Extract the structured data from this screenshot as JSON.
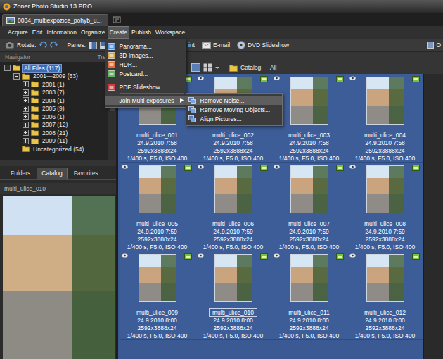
{
  "window": {
    "title": "Zoner Photo Studio 13 PRO"
  },
  "document_tab": {
    "label": "0034_multiexpozice_pohyb_u..."
  },
  "menu_bar": [
    {
      "label": "Acquire",
      "selected": false
    },
    {
      "label": "Edit",
      "selected": false
    },
    {
      "label": "Information",
      "selected": false
    },
    {
      "label": "Organize",
      "selected": false
    },
    {
      "label": "Create",
      "selected": true
    },
    {
      "label": "Publish",
      "selected": false
    },
    {
      "label": "Workspace",
      "selected": false
    }
  ],
  "create_menu": {
    "items": [
      {
        "label": "Panorama...",
        "kind": "command",
        "separator_before": false,
        "highlighted": false
      },
      {
        "label": "3D Images...",
        "kind": "command",
        "separator_before": false,
        "highlighted": false
      },
      {
        "label": "HDR...",
        "kind": "command",
        "separator_before": false,
        "highlighted": false
      },
      {
        "label": "Postcard...",
        "kind": "command",
        "separator_before": false,
        "highlighted": false
      },
      {
        "label": "PDF Slideshow...",
        "kind": "command",
        "separator_before": true,
        "highlighted": false
      },
      {
        "label": "Join Multi-exposures",
        "kind": "submenu",
        "separator_before": true,
        "highlighted": true
      }
    ],
    "submenu": [
      {
        "label": "Remove Noise...",
        "highlighted": true
      },
      {
        "label": "Remove Moving Objects...",
        "highlighted": false
      },
      {
        "label": "Align Pictures...",
        "highlighted": false
      }
    ]
  },
  "toolbar": {
    "rotate_label": "Rotate:",
    "panes_label": "Panes:",
    "items": [
      {
        "label": "int",
        "kind": "text"
      },
      {
        "label": "E-mail",
        "kind": "email"
      },
      {
        "label": "DVD Slideshow",
        "kind": "disc"
      }
    ],
    "edge_item": {
      "label": "O",
      "kind": "tool"
    }
  },
  "navigator": {
    "title": "Navigator",
    "second_tab": "Tre"
  },
  "tree": [
    {
      "label": "All Files (117)",
      "depth": 0,
      "kind": "branch",
      "expanded": true,
      "selected": true
    },
    {
      "label": "2001—2009 (63)",
      "depth": 1,
      "kind": "branch",
      "expanded": true,
      "selected": false
    },
    {
      "label": "2001 (1)",
      "depth": 2,
      "kind": "branch",
      "expanded": false,
      "selected": false
    },
    {
      "label": "2003 (7)",
      "depth": 2,
      "kind": "branch",
      "expanded": false,
      "selected": false
    },
    {
      "label": "2004 (1)",
      "depth": 2,
      "kind": "branch",
      "expanded": false,
      "selected": false
    },
    {
      "label": "2005 (9)",
      "depth": 2,
      "kind": "branch",
      "expanded": false,
      "selected": false
    },
    {
      "label": "2006 (1)",
      "depth": 2,
      "kind": "branch",
      "expanded": false,
      "selected": false
    },
    {
      "label": "2007 (12)",
      "depth": 2,
      "kind": "branch",
      "expanded": false,
      "selected": false
    },
    {
      "label": "2008 (21)",
      "depth": 2,
      "kind": "branch",
      "expanded": false,
      "selected": false
    },
    {
      "label": "2009 (11)",
      "depth": 2,
      "kind": "branch",
      "expanded": false,
      "selected": false
    },
    {
      "label": "Uncategorized (54)",
      "depth": 1,
      "kind": "leaf",
      "expanded": false,
      "selected": false
    }
  ],
  "panel_tabs": [
    {
      "label": "Folders",
      "selected": false
    },
    {
      "label": "Catalog",
      "selected": true
    },
    {
      "label": "Favorites",
      "selected": false
    }
  ],
  "preview": {
    "title": "multi_ulice_010"
  },
  "browser": {
    "path": "Catalog — All"
  },
  "thumbnails": [
    {
      "name": "multi_ulice_001",
      "date": "24.9.2010 7:58",
      "size": "2592x3888x24",
      "exposure": "1/400 s, F5.0, ISO 400",
      "selected": true,
      "focused": false
    },
    {
      "name": "multi_ulice_002",
      "date": "24.9.2010 7:58",
      "size": "2592x3888x24",
      "exposure": "1/400 s, F5.0, ISO 400",
      "selected": true,
      "focused": false
    },
    {
      "name": "multi_ulice_003",
      "date": "24.9.2010 7:58",
      "size": "2592x3888x24",
      "exposure": "1/400 s, F5.0, ISO 400",
      "selected": true,
      "focused": false
    },
    {
      "name": "multi_ulice_004",
      "date": "24.9.2010 7:58",
      "size": "2592x3888x24",
      "exposure": "1/400 s, F5.0, ISO 400",
      "selected": true,
      "focused": false
    },
    {
      "name": "multi_ulice_005",
      "date": "24.9.2010 7:59",
      "size": "2592x3888x24",
      "exposure": "1/400 s, F5.0, ISO 400",
      "selected": true,
      "focused": false
    },
    {
      "name": "multi_ulice_006",
      "date": "24.9.2010 7:59",
      "size": "2592x3888x24",
      "exposure": "1/400 s, F5.0, ISO 400",
      "selected": true,
      "focused": false
    },
    {
      "name": "multi_ulice_007",
      "date": "24.9.2010 7:59",
      "size": "2592x3888x24",
      "exposure": "1/400 s, F5.0, ISO 400",
      "selected": true,
      "focused": false
    },
    {
      "name": "multi_ulice_008",
      "date": "24.9.2010 7:59",
      "size": "2592x3888x24",
      "exposure": "1/400 s, F5.0, ISO 400",
      "selected": true,
      "focused": false
    },
    {
      "name": "multi_ulice_009",
      "date": "24.9.2010 8:00",
      "size": "2592x3888x24",
      "exposure": "1/400 s, F5.0, ISO 400",
      "selected": true,
      "focused": false
    },
    {
      "name": "multi_ulice_010",
      "date": "24.9.2010 8:00",
      "size": "2592x3888x24",
      "exposure": "1/400 s, F5.0, ISO 400",
      "selected": true,
      "focused": true
    },
    {
      "name": "multi_ulice_011",
      "date": "24.9.2010 8:00",
      "size": "2592x3888x24",
      "exposure": "1/400 s, F5.0, ISO 400",
      "selected": true,
      "focused": false
    },
    {
      "name": "multi_ulice_012",
      "date": "24.9.2010 8:00",
      "size": "2592x3888x24",
      "exposure": "1/400 s, F5.0, ISO 400",
      "selected": true,
      "focused": false
    }
  ]
}
